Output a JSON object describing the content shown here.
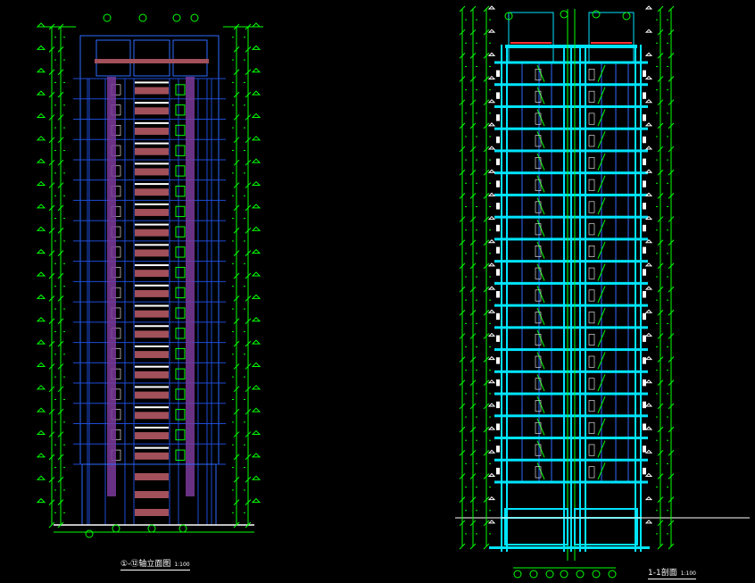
{
  "drawing": {
    "elevation": {
      "title": "①-⑫轴立面图",
      "scale": "1:100",
      "floors": 19,
      "colors": {
        "outline": "#2e6bff",
        "column": "#7a3a9a",
        "balcony": "#a2505a",
        "dimension": "#00ff00",
        "grid": "#1e4bd6",
        "white": "#ffffff"
      }
    },
    "section": {
      "title": "1-1剖面",
      "scale": "1:100",
      "floors": 19,
      "colors": {
        "structure": "#00e5ff",
        "dimension": "#00ff00",
        "outline": "#2e6bff",
        "white": "#ffffff",
        "accent": "#ff3030"
      }
    }
  }
}
